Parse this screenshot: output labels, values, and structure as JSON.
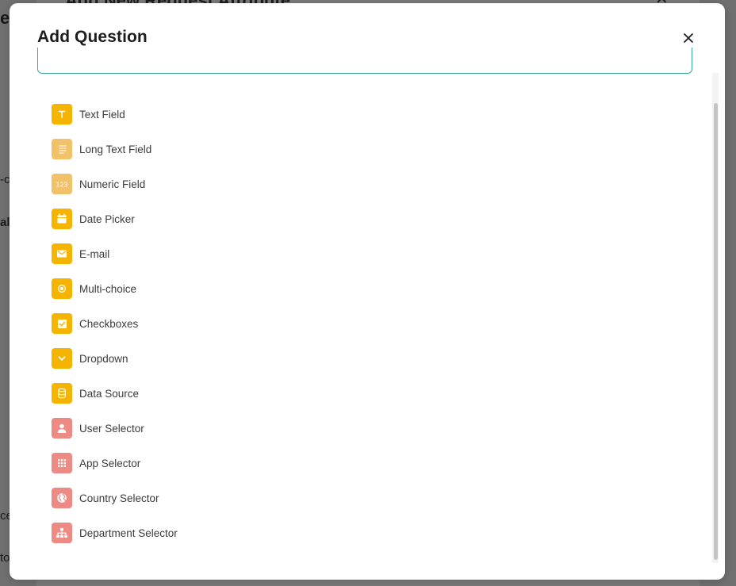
{
  "background": {
    "dialog_title": "Add New Request Attribute",
    "fragments": [
      "e",
      "-c",
      "al",
      "ce",
      "to"
    ]
  },
  "modal": {
    "title": "Add Question",
    "search": {
      "value": "",
      "placeholder": ""
    },
    "items": [
      {
        "label": "Text Field",
        "icon": "text-field-icon",
        "color": "#f5b400"
      },
      {
        "label": "Long Text Field",
        "icon": "long-text-icon",
        "color": "#f2c26b"
      },
      {
        "label": "Numeric Field",
        "icon": "numeric-icon",
        "color": "#f2c26b"
      },
      {
        "label": "Date Picker",
        "icon": "calendar-icon",
        "color": "#f5b400"
      },
      {
        "label": "E-mail",
        "icon": "envelope-icon",
        "color": "#f5b400"
      },
      {
        "label": "Multi-choice",
        "icon": "radio-icon",
        "color": "#f5b400"
      },
      {
        "label": "Checkboxes",
        "icon": "checkbox-icon",
        "color": "#f5b400"
      },
      {
        "label": "Dropdown",
        "icon": "chevron-down-icon",
        "color": "#f5b400"
      },
      {
        "label": "Data Source",
        "icon": "database-icon",
        "color": "#f5b400"
      },
      {
        "label": "User Selector",
        "icon": "user-icon",
        "color": "#ee8a84"
      },
      {
        "label": "App Selector",
        "icon": "app-grid-icon",
        "color": "#ee8a84"
      },
      {
        "label": "Country Selector",
        "icon": "globe-icon",
        "color": "#ee8a84"
      },
      {
        "label": "Department Selector",
        "icon": "org-chart-icon",
        "color": "#ee8a84"
      }
    ]
  },
  "colors": {
    "accent": "#3aa798",
    "yellow": "#f5b400",
    "light_yellow": "#f2c26b",
    "coral": "#ee8a84"
  }
}
